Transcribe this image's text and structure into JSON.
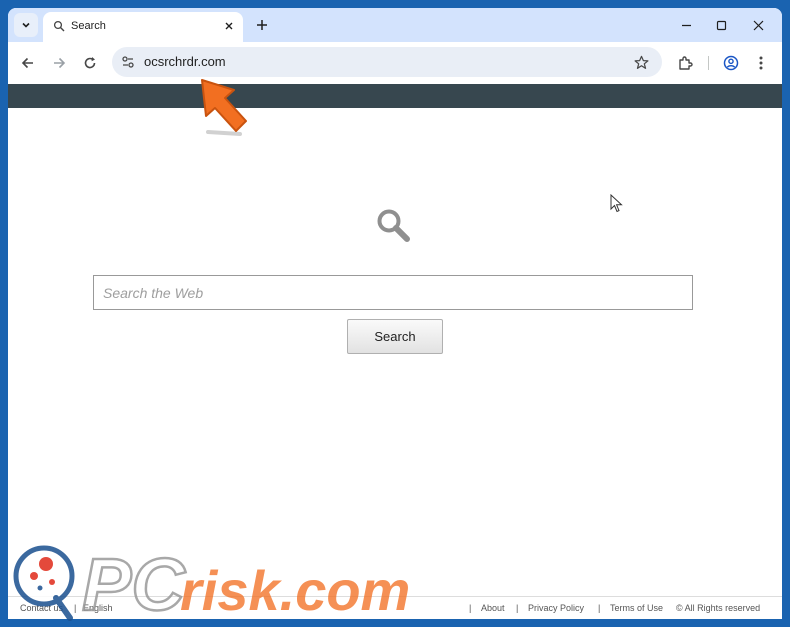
{
  "browser": {
    "tab": {
      "title": "Search"
    },
    "address_bar": {
      "url": "ocsrchrdr.com"
    }
  },
  "page": {
    "search": {
      "placeholder": "Search the Web",
      "button_label": "Search"
    },
    "footer": {
      "links": [
        "Contact us",
        "English",
        "About",
        "Privacy Policy",
        "Terms of Use"
      ],
      "copyright": "© All Rights reserved",
      "separator": "|"
    },
    "colors": {
      "header_bar": "#37474f",
      "tab_strip": "#d3e3fd",
      "arrow": "#f26f21"
    }
  },
  "overlay": {
    "watermark": {
      "brand": "PCrisk.com"
    }
  }
}
